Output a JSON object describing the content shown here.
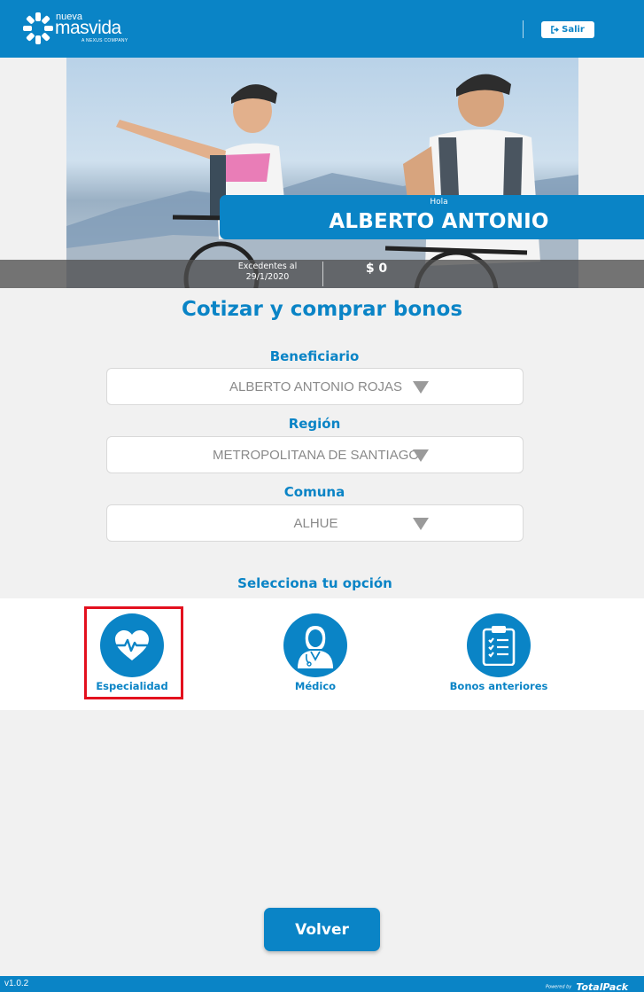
{
  "header": {
    "logo": {
      "small": "nueva",
      "main": "masvida",
      "tagline": "A NEXUS COMPANY"
    },
    "logout_label": "Salir",
    "logout_icon": "sign-out-icon"
  },
  "hero": {
    "greeting": "Hola",
    "user_name": "ALBERTO ANTONIO",
    "balance_label": "Excedentes al 29/1/2020",
    "balance_value": "$ 0"
  },
  "form": {
    "title": "Cotizar y comprar bonos",
    "beneficiario": {
      "label": "Beneficiario",
      "value": "ALBERTO ANTONIO ROJAS"
    },
    "region": {
      "label": "Región",
      "value": "METROPOLITANA DE SANTIAGO"
    },
    "comuna": {
      "label": "Comuna",
      "value": "ALHUE"
    }
  },
  "options": {
    "title": "Selecciona tu opción",
    "items": [
      {
        "label": "Especialidad",
        "icon": "heart-pulse-icon"
      },
      {
        "label": "Médico",
        "icon": "doctor-icon"
      },
      {
        "label": "Bonos anteriores",
        "icon": "clipboard-checklist-icon"
      }
    ]
  },
  "back_label": "Volver",
  "footer": {
    "version": "v1.0.2",
    "powered_small": "Powered by",
    "powered_brand": "TotalPack"
  },
  "colors": {
    "primary": "#0a84c6",
    "highlight": "#e3101e",
    "background": "#f1f1f1"
  }
}
